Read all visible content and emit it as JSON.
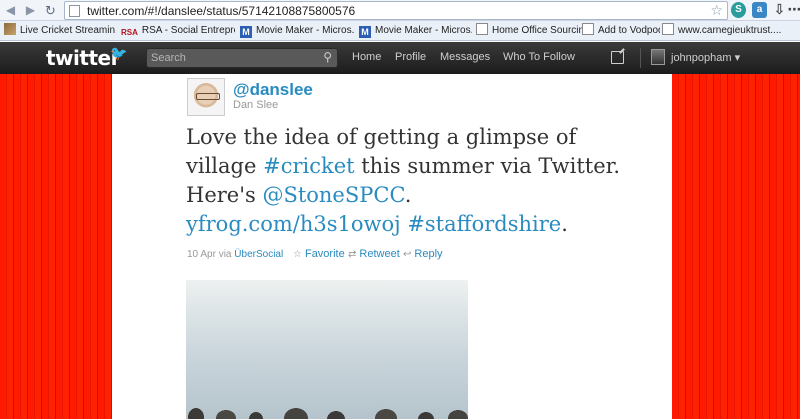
{
  "browser": {
    "url": "twitter.com/#!/danslee/status/57142108875800576",
    "nav": {
      "back": "◀",
      "forward": "▶",
      "reload": "↻",
      "star": "☆"
    },
    "extensions": [
      "S",
      "a",
      "⇩",
      "⋯"
    ],
    "bookmarks": [
      {
        "label": "Live Cricket Streamin...",
        "icon": "image-icon"
      },
      {
        "label": "RSA - Social Entrepre...",
        "icon": "rsa-icon",
        "icon_text": "RSA"
      },
      {
        "label": "Movie Maker - Micros...",
        "icon": "m-icon",
        "icon_text": "M"
      },
      {
        "label": "Movie Maker - Micros...",
        "icon": "m-icon",
        "icon_text": "M"
      },
      {
        "label": "Home Office Sourcing",
        "icon": "doc-icon"
      },
      {
        "label": "Add to Vodpod",
        "icon": "doc-icon"
      },
      {
        "label": "www.carnegieuktrust....",
        "icon": "doc-icon"
      }
    ]
  },
  "twitter": {
    "logo": "twitter",
    "search_placeholder": "Search",
    "nav": {
      "home": "Home",
      "profile": "Profile",
      "messages": "Messages",
      "who_to_follow": "Who To Follow"
    },
    "username": "johnpopham ▾"
  },
  "tweet": {
    "screen_name": "@danslee",
    "real_name": "Dan Slee",
    "text_1": "Love the idea of getting a glimpse of village ",
    "hashtag_1": "#cricket",
    "text_2": " this summer via Twitter. Here's ",
    "mention": "@StoneSPCC",
    "text_3": ". ",
    "link": "yfrog.com/h3s1owoj",
    "text_4": " ",
    "hashtag_2": "#staffordshire",
    "text_5": ".",
    "date": "10 Apr",
    "via": "via",
    "source": "ÜberSocial",
    "actions": {
      "favorite": "Favorite",
      "retweet": "Retweet",
      "reply": "Reply"
    }
  },
  "colors": {
    "link": "#2a8bc0",
    "background_red": "#ff1a00",
    "topbar": "#222222"
  }
}
